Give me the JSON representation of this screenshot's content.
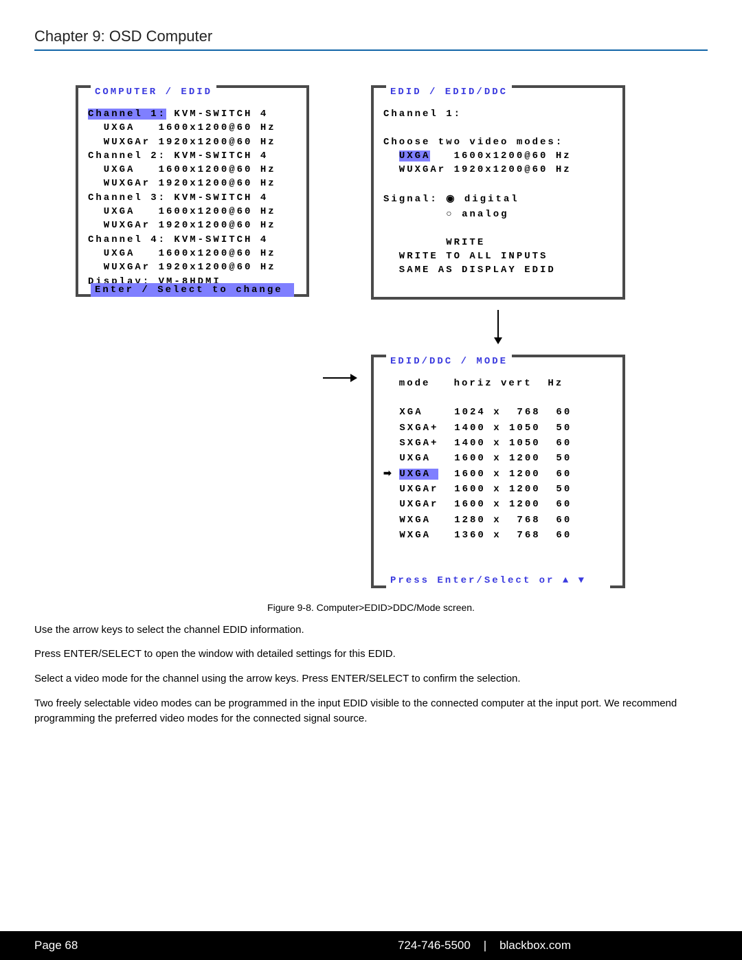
{
  "chapter_title": "Chapter 9: OSD Computer",
  "panel_computer": {
    "title": "COMPUTER / EDID",
    "channels": [
      {
        "label": "Channel 1:",
        "device": "KVM-SWITCH 4",
        "modes": [
          "UXGA   1600x1200@60 Hz",
          "WUXGAr 1920x1200@60 Hz"
        ],
        "selected": true
      },
      {
        "label": "Channel 2:",
        "device": "KVM-SWITCH 4",
        "modes": [
          "UXGA   1600x1200@60 Hz",
          "WUXGAr 1920x1200@60 Hz"
        ],
        "selected": false
      },
      {
        "label": "Channel 3:",
        "device": "KVM-SWITCH 4",
        "modes": [
          "UXGA   1600x1200@60 Hz",
          "WUXGAr 1920x1200@60 Hz"
        ],
        "selected": false
      },
      {
        "label": "Channel 4:",
        "device": "KVM-SWITCH 4",
        "modes": [
          "UXGA   1600x1200@60 Hz",
          "WUXGAr 1920x1200@60 Hz"
        ],
        "selected": false
      }
    ],
    "display_line": "Display: VM-8HDMI",
    "footer": "Enter / Select to change"
  },
  "panel_edidddc": {
    "title": "EDID / EDID/DDC",
    "channel_line": "Channel 1:",
    "choose_line": "Choose two video modes:",
    "mode1": {
      "name": "UXGA",
      "res": "1600x1200@60 Hz",
      "selected": true
    },
    "mode2": {
      "name": "WUXGAr",
      "res": "1920x1200@60 Hz",
      "selected": false
    },
    "signal_label": "Signal:",
    "sig_digital": "digital",
    "sig_analog": "analog",
    "action_write": "WRITE",
    "action_write_all": "WRITE TO ALL INPUTS",
    "action_same": "SAME AS DISPLAY EDID"
  },
  "panel_mode": {
    "title": "EDID/DDC / MODE",
    "header": {
      "mode": "mode",
      "horiz": "horiz",
      "vert": "vert",
      "hz": "Hz"
    },
    "rows": [
      {
        "name": "XGA",
        "h": "1024",
        "v": " 768",
        "hz": "60",
        "selected": false
      },
      {
        "name": "SXGA+",
        "h": "1400",
        "v": "1050",
        "hz": "50",
        "selected": false
      },
      {
        "name": "SXGA+",
        "h": "1400",
        "v": "1050",
        "hz": "60",
        "selected": false
      },
      {
        "name": "UXGA",
        "h": "1600",
        "v": "1200",
        "hz": "50",
        "selected": false
      },
      {
        "name": "UXGA",
        "h": "1600",
        "v": "1200",
        "hz": "60",
        "selected": true
      },
      {
        "name": "UXGAr",
        "h": "1600",
        "v": "1200",
        "hz": "50",
        "selected": false
      },
      {
        "name": "UXGAr",
        "h": "1600",
        "v": "1200",
        "hz": "60",
        "selected": false
      },
      {
        "name": "WXGA",
        "h": "1280",
        "v": " 768",
        "hz": "60",
        "selected": false
      },
      {
        "name": "WXGA",
        "h": "1360",
        "v": " 768",
        "hz": "60",
        "selected": false
      }
    ],
    "footer": "Press Enter/Select or  ▲ ▼"
  },
  "caption": "Figure 9-8. Computer>EDID>DDC/Mode screen.",
  "paragraphs": [
    "Use the arrow keys to select the channel EDID information.",
    "Press ENTER/SELECT to open the window with detailed settings for this EDID.",
    "Select a video mode for the channel using the arrow keys. Press ENTER/SELECT to confirm the selection.",
    "Two freely selectable video modes can be programmed in the input EDID visible to the connected computer at the input port. We recommend programming the preferred video modes for the connected signal source."
  ],
  "footer": {
    "page_label": "Page 68",
    "phone": "724-746-5500",
    "sep": "|",
    "site": "blackbox.com"
  }
}
